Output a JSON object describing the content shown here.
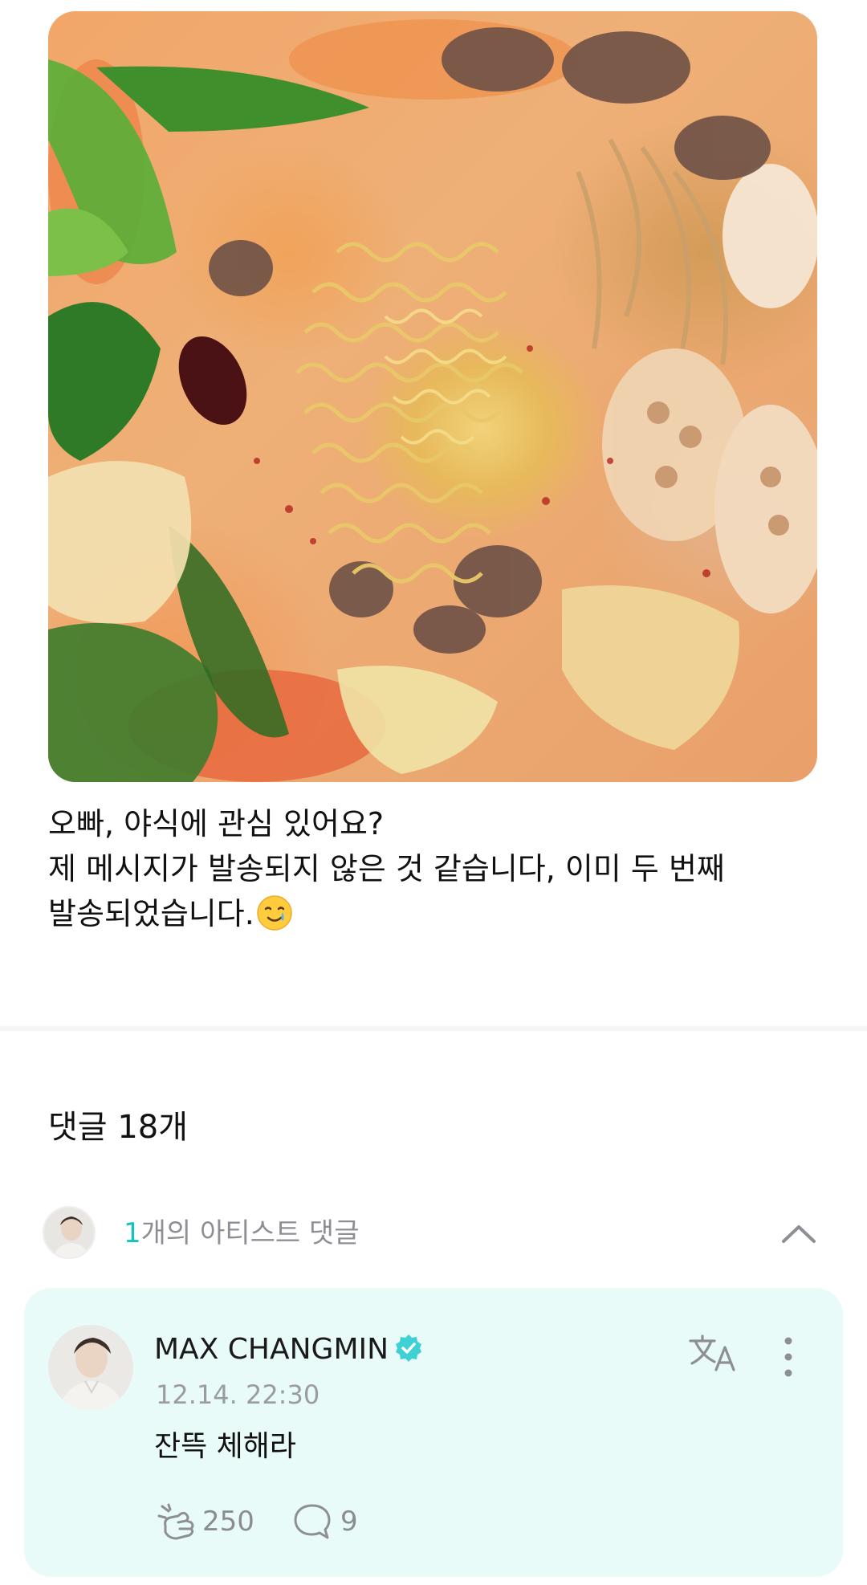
{
  "post": {
    "image_subject": "bowl of spicy noodle hotpot",
    "lines": [
      "오빠, 야식에 관심 있어요?",
      "제 메시지가 발송되지 않은 것 같습니다, 이미 두 번째",
      "발송되었습니다."
    ],
    "emoji": "smiling-face-with-tear"
  },
  "comments": {
    "title": "댓글 18개",
    "artist_summary": {
      "count": "1",
      "label": "개의 아티스트 댓글"
    },
    "artist_comment": {
      "author": "MAX CHANGMIN",
      "verified": true,
      "time": "12.14. 22:30",
      "body": "잔뜩 체해라",
      "reaction_count": "250",
      "reply_count": "9"
    }
  },
  "colors": {
    "accent": "#12c3c0",
    "card_background": "#e9fbf8",
    "muted_text": "#8d8f95",
    "verified_badge": "#3fd0d3"
  },
  "icons": {
    "collapse": "chevron-up-icon",
    "translate": "translate-icon",
    "more": "more-vertical-icon",
    "reaction": "reaction-icon",
    "reply": "speech-bubble-icon",
    "verified": "verified-badge-icon"
  }
}
